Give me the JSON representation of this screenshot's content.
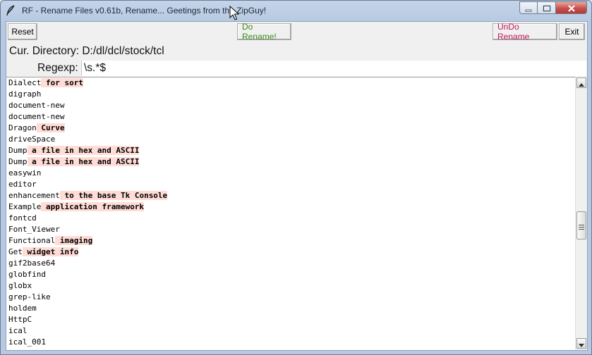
{
  "window": {
    "title": "RF - Rename Files v0.61b, Rename...  Geetings from the ZipGuy!"
  },
  "toolbar": {
    "reset_label": "Reset",
    "do_rename_label": "Do Rename!",
    "undo_rename_label": "UnDo Rename",
    "exit_label": "Exit"
  },
  "directory": {
    "text": "Cur. Directory: D:/dl/dcl/stock/tcl"
  },
  "regexp": {
    "label": "Regexp:",
    "value": "\\s.*$"
  },
  "colors": {
    "do_rename": "#3a8a1a",
    "undo_rename": "#c2185b",
    "match_highlight": "#ffdcd6"
  },
  "icons": {
    "app": "feather-icon",
    "minimize": "minimize-icon",
    "maximize": "maximize-icon",
    "close": "close-icon",
    "scroll_up": "arrow-up-icon",
    "scroll_down": "arrow-down-icon",
    "cursor": "mouse-pointer-icon"
  },
  "files": [
    {
      "pre": "Dialect",
      "match": " for sort"
    },
    {
      "pre": "digraph",
      "match": ""
    },
    {
      "pre": "document-new",
      "match": ""
    },
    {
      "pre": "document-new",
      "match": ""
    },
    {
      "pre": "Dragon",
      "match": " Curve"
    },
    {
      "pre": "driveSpace",
      "match": ""
    },
    {
      "pre": "Dump",
      "match": " a file in hex and ASCII"
    },
    {
      "pre": "Dump",
      "match": " a file in hex and ASCII"
    },
    {
      "pre": "easywin",
      "match": ""
    },
    {
      "pre": "editor",
      "match": ""
    },
    {
      "pre": "enhancement",
      "match": " to the base Tk Console"
    },
    {
      "pre": "Example",
      "match": " application framework"
    },
    {
      "pre": "fontcd",
      "match": ""
    },
    {
      "pre": "Font_Viewer",
      "match": ""
    },
    {
      "pre": "Functional",
      "match": " imaging"
    },
    {
      "pre": "Get",
      "match": " widget info"
    },
    {
      "pre": "gif2base64",
      "match": ""
    },
    {
      "pre": "globfind",
      "match": ""
    },
    {
      "pre": "globx",
      "match": ""
    },
    {
      "pre": "grep-like",
      "match": ""
    },
    {
      "pre": "holdem",
      "match": ""
    },
    {
      "pre": "HttpC",
      "match": ""
    },
    {
      "pre": "ical",
      "match": ""
    },
    {
      "pre": "ical_001",
      "match": ""
    }
  ]
}
